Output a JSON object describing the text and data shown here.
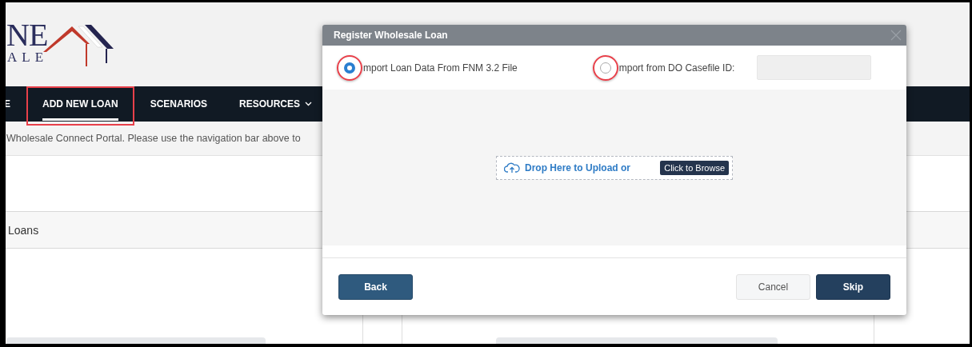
{
  "logo": {
    "line_1": "NE",
    "line_2": "ALE"
  },
  "nav": {
    "items": [
      {
        "label": "E",
        "selected": false,
        "highlighted": false,
        "has_menu": false
      },
      {
        "label": "ADD NEW LOAN",
        "selected": true,
        "highlighted": true,
        "has_menu": false
      },
      {
        "label": "SCENARIOS",
        "selected": false,
        "highlighted": false,
        "has_menu": false
      },
      {
        "label": "RESOURCES",
        "selected": false,
        "highlighted": false,
        "has_menu": true
      }
    ]
  },
  "welcome_text": "Wholesale Connect Portal. Please use the navigation bar above to",
  "section": {
    "title": "Loans"
  },
  "modal": {
    "title": "Register Wholesale Loan",
    "options": [
      {
        "label": "mport Loan Data From FNM 3.2 File",
        "selected": true,
        "highlighted": true,
        "kind": "plain"
      },
      {
        "label": "mport from DO Casefile ID:",
        "selected": false,
        "highlighted": true,
        "kind": "with-field"
      }
    ],
    "upload": {
      "text": "Drop Here to Upload or",
      "button": "Click to Browse"
    },
    "buttons": [
      {
        "label": "Back",
        "kind": "secondary"
      },
      {
        "label": "Cancel",
        "kind": "plain"
      },
      {
        "label": "Skip",
        "kind": "primary"
      }
    ]
  }
}
